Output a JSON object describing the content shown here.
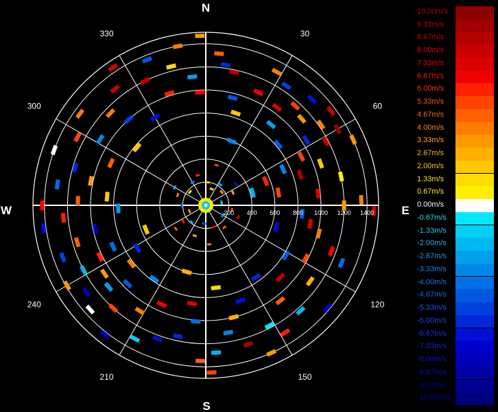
{
  "chart_data": {
    "type": "polar-radial-velocity",
    "compass": {
      "north": "N",
      "east": "E",
      "south": "S",
      "west": "W"
    },
    "angle_labels": [
      {
        "angle": 30,
        "text": "30"
      },
      {
        "angle": 60,
        "text": "60"
      },
      {
        "angle": 120,
        "text": "120"
      },
      {
        "angle": 150,
        "text": "150"
      },
      {
        "angle": 210,
        "text": "210"
      },
      {
        "angle": 240,
        "text": "240"
      },
      {
        "angle": 300,
        "text": "300"
      },
      {
        "angle": 330,
        "text": "330"
      }
    ],
    "range_rings": [
      200,
      400,
      600,
      800,
      1000,
      1200,
      1400
    ],
    "range_labels": [
      {
        "value": 200,
        "text": "200"
      },
      {
        "value": 400,
        "text": "400"
      },
      {
        "value": 600,
        "text": "600"
      },
      {
        "value": 800,
        "text": "800"
      },
      {
        "value": 1000,
        "text": "1000"
      },
      {
        "value": 1200,
        "text": "1200"
      },
      {
        "value": 1400,
        "text": "1400"
      }
    ],
    "range_max": 1400,
    "spoke_angles": [
      0,
      30,
      60,
      90,
      120,
      150,
      180,
      210,
      240,
      270,
      300,
      330
    ],
    "colorbar": {
      "min": -10,
      "max": 10,
      "unit": "m/s",
      "entries": [
        {
          "label": "10.00m/s",
          "value": 10.0,
          "color": "#8c0000",
          "text_color": "#b00000"
        },
        {
          "label": "9.33m/s",
          "value": 9.33,
          "color": "#a00000",
          "text_color": "#c00000"
        },
        {
          "label": "8.67m/s",
          "value": 8.67,
          "color": "#b40000",
          "text_color": "#d00000"
        },
        {
          "label": "8.00m/s",
          "value": 8.0,
          "color": "#c80000",
          "text_color": "#e00000"
        },
        {
          "label": "7.33m/s",
          "value": 7.33,
          "color": "#dc0000",
          "text_color": "#ee0000"
        },
        {
          "label": "6.67m/s",
          "value": 6.67,
          "color": "#f00000",
          "text_color": "#ff1010"
        },
        {
          "label": "6.00m/s",
          "value": 6.0,
          "color": "#ff2000",
          "text_color": "#ff3010"
        },
        {
          "label": "5.33m/s",
          "value": 5.33,
          "color": "#ff4400",
          "text_color": "#ff5020"
        },
        {
          "label": "4.67m/s",
          "value": 4.67,
          "color": "#ff6000",
          "text_color": "#ff6a20"
        },
        {
          "label": "4.00m/s",
          "value": 4.0,
          "color": "#ff7c00",
          "text_color": "#ff8420"
        },
        {
          "label": "3.33m/s",
          "value": 3.33,
          "color": "#ff9800",
          "text_color": "#ff9c20"
        },
        {
          "label": "2.67m/s",
          "value": 2.67,
          "color": "#ffb000",
          "text_color": "#ffb420"
        },
        {
          "label": "2.00m/s",
          "value": 2.0,
          "color": "#ffc800",
          "text_color": "#ffcc20"
        },
        {
          "label": "1.33m/s",
          "value": 1.33,
          "color": "#ffdc00",
          "text_color": "#ffe020"
        },
        {
          "label": "0.67m/s",
          "value": 0.67,
          "color": "#fff000",
          "text_color": "#fff020"
        },
        {
          "label": "0.00m/s",
          "value": 0.0,
          "color": "#ffffff",
          "text_color": "#ffffff"
        },
        {
          "label": "-0.67m/s",
          "value": -0.67,
          "color": "#00e8f8",
          "text_color": "#20e0f0"
        },
        {
          "label": "-1.33m/s",
          "value": -1.33,
          "color": "#00d0f4",
          "text_color": "#20c8f0"
        },
        {
          "label": "-2.00m/s",
          "value": -2.0,
          "color": "#00b8f0",
          "text_color": "#20b0f0"
        },
        {
          "label": "-2.67m/s",
          "value": -2.67,
          "color": "#00a0ec",
          "text_color": "#2098f0"
        },
        {
          "label": "-3.33m/s",
          "value": -3.33,
          "color": "#0088e8",
          "text_color": "#2080f0"
        },
        {
          "label": "-4.00m/s",
          "value": -4.0,
          "color": "#0070e4",
          "text_color": "#2070f0"
        },
        {
          "label": "-4.67m/s",
          "value": -4.67,
          "color": "#0058e0",
          "text_color": "#2060f0"
        },
        {
          "label": "-5.33m/s",
          "value": -5.33,
          "color": "#0040dc",
          "text_color": "#2050f0"
        },
        {
          "label": "-6.00m/s",
          "value": -6.0,
          "color": "#0028d8",
          "text_color": "#2040f0"
        },
        {
          "label": "-6.67m/s",
          "value": -6.67,
          "color": "#0010d4",
          "text_color": "#2030f0"
        },
        {
          "label": "-7.33m/s",
          "value": -7.33,
          "color": "#0000cc",
          "text_color": "#1020e0"
        },
        {
          "label": "-8.00m/s",
          "value": -8.0,
          "color": "#0000b8",
          "text_color": "#1010d0"
        },
        {
          "label": "-8.67m/s",
          "value": -8.67,
          "color": "#0000a4",
          "text_color": "#0808c0"
        },
        {
          "label": "-9.33m/s",
          "value": -9.33,
          "color": "#000090",
          "text_color": "#0000b0"
        },
        {
          "label": "-10.00m/s",
          "value": -10.0,
          "color": "#00007c",
          "text_color": "#0000a0"
        }
      ]
    },
    "bins": [
      {
        "az": 5,
        "r": 1320,
        "v": 4.7
      },
      {
        "az": 8,
        "r": 1230,
        "v": -6.0
      },
      {
        "az": 12,
        "r": 1180,
        "v": 8.6
      },
      {
        "az": 14,
        "r": 960,
        "v": -4.5
      },
      {
        "az": 18,
        "r": 840,
        "v": 2.2
      },
      {
        "az": 22,
        "r": 600,
        "v": -3.4
      },
      {
        "az": 25,
        "r": 1080,
        "v": 6.5
      },
      {
        "az": 28,
        "r": 1310,
        "v": 3.8
      },
      {
        "az": 34,
        "r": 1250,
        "v": -5.5
      },
      {
        "az": 36,
        "r": 1050,
        "v": 7.3
      },
      {
        "az": 39,
        "r": 900,
        "v": -2.7
      },
      {
        "az": 42,
        "r": 1160,
        "v": 5.0
      },
      {
        "az": 45,
        "r": 1300,
        "v": -7.0
      },
      {
        "az": 48,
        "r": 1120,
        "v": 3.3
      },
      {
        "az": 50,
        "r": 820,
        "v": -4.4
      },
      {
        "az": 53,
        "r": 1360,
        "v": 8.0
      },
      {
        "az": 55,
        "r": 1220,
        "v": 4.2
      },
      {
        "az": 57,
        "r": 1040,
        "v": -6.3
      },
      {
        "az": 60,
        "r": 1320,
        "v": 9.0
      },
      {
        "az": 62,
        "r": 1180,
        "v": 7.8
      },
      {
        "az": 63,
        "r": 930,
        "v": 5.6
      },
      {
        "az": 65,
        "r": 740,
        "v": -3.2
      },
      {
        "az": 66,
        "r": 1400,
        "v": 3.0
      },
      {
        "az": 68,
        "r": 560,
        "v": 6.2
      },
      {
        "az": 70,
        "r": 1060,
        "v": 1.8
      },
      {
        "az": 72,
        "r": 860,
        "v": 8.4
      },
      {
        "az": 75,
        "r": 420,
        "v": -2.0
      },
      {
        "az": 78,
        "r": 1200,
        "v": 0.8
      },
      {
        "az": 80,
        "r": 640,
        "v": 5.3
      },
      {
        "az": 84,
        "r": 980,
        "v": 7.0
      },
      {
        "az": 88,
        "r": 1350,
        "v": 4.0
      },
      {
        "az": 90,
        "r": 1200,
        "v": 3.0
      },
      {
        "az": 92,
        "r": 1460,
        "v": 8.0
      },
      {
        "az": 95,
        "r": 840,
        "v": -5.0
      },
      {
        "az": 100,
        "r": 920,
        "v": 7.5
      },
      {
        "az": 104,
        "r": 1010,
        "v": 4.3
      },
      {
        "az": 107,
        "r": 640,
        "v": -6.6
      },
      {
        "az": 110,
        "r": 1160,
        "v": 6.9
      },
      {
        "az": 113,
        "r": 1280,
        "v": -3.7
      },
      {
        "az": 118,
        "r": 980,
        "v": 5.5
      },
      {
        "az": 122,
        "r": 820,
        "v": -4.9
      },
      {
        "az": 126,
        "r": 1120,
        "v": 2.5
      },
      {
        "az": 130,
        "r": 1380,
        "v": -7.4
      },
      {
        "az": 134,
        "r": 900,
        "v": 7.7
      },
      {
        "az": 138,
        "r": 1230,
        "v": -2.3
      },
      {
        "az": 142,
        "r": 1050,
        "v": 4.6
      },
      {
        "az": 145,
        "r": 760,
        "v": -5.8
      },
      {
        "az": 148,
        "r": 1300,
        "v": 6.1
      },
      {
        "az": 152,
        "r": 1180,
        "v": -0.5
      },
      {
        "az": 156,
        "r": 1400,
        "v": 3.5
      },
      {
        "az": 160,
        "r": 880,
        "v": -6.9
      },
      {
        "az": 163,
        "r": 1260,
        "v": 9.4
      },
      {
        "az": 166,
        "r": 1000,
        "v": 2.8
      },
      {
        "az": 170,
        "r": 1120,
        "v": -3.1
      },
      {
        "az": 173,
        "r": 720,
        "v": 1.6
      },
      {
        "az": 176,
        "r": 1280,
        "v": -2.2
      },
      {
        "az": 178,
        "r": 1450,
        "v": 5.2
      },
      {
        "az": 182,
        "r": 1350,
        "v": 4.4
      },
      {
        "az": 185,
        "r": 1010,
        "v": -4.2
      },
      {
        "az": 188,
        "r": 860,
        "v": 7.6
      },
      {
        "az": 192,
        "r": 1160,
        "v": -5.9
      },
      {
        "az": 196,
        "r": 600,
        "v": 2.6
      },
      {
        "az": 200,
        "r": 1230,
        "v": -6.4
      },
      {
        "az": 204,
        "r": 940,
        "v": 6.6
      },
      {
        "az": 208,
        "r": 1310,
        "v": -1.4
      },
      {
        "az": 212,
        "r": 1080,
        "v": 3.9
      },
      {
        "az": 215,
        "r": 780,
        "v": -3.6
      },
      {
        "az": 218,
        "r": 1420,
        "v": -7.8
      },
      {
        "az": 222,
        "r": 1200,
        "v": 5.4
      },
      {
        "az": 225,
        "r": 960,
        "v": -4.6
      },
      {
        "az": 228,
        "r": 1350,
        "v": 0.3
      },
      {
        "az": 230,
        "r": 1100,
        "v": -2.5
      },
      {
        "az": 232,
        "r": 820,
        "v": 4.1
      },
      {
        "az": 234,
        "r": 1280,
        "v": -8.3
      },
      {
        "az": 236,
        "r": 1060,
        "v": 3.1
      },
      {
        "az": 238,
        "r": 700,
        "v": -6.1
      },
      {
        "az": 240,
        "r": 1390,
        "v": 3.6
      },
      {
        "az": 242,
        "r": 1200,
        "v": -1.9
      },
      {
        "az": 244,
        "r": 1020,
        "v": 6.3
      },
      {
        "az": 246,
        "r": 880,
        "v": -3.9
      },
      {
        "az": 248,
        "r": 560,
        "v": 2.0
      },
      {
        "az": 250,
        "r": 1320,
        "v": -5.1
      },
      {
        "az": 254,
        "r": 1160,
        "v": 4.8
      },
      {
        "az": 258,
        "r": 980,
        "v": -7.2
      },
      {
        "az": 262,
        "r": 1420,
        "v": -6.8
      },
      {
        "az": 265,
        "r": 1240,
        "v": 5.8
      },
      {
        "az": 268,
        "r": 760,
        "v": -2.9
      },
      {
        "az": 270,
        "r": 1420,
        "v": 6.7
      },
      {
        "az": 272,
        "r": 1110,
        "v": 4.5
      },
      {
        "az": 275,
        "r": 860,
        "v": 2.3
      },
      {
        "az": 278,
        "r": 1300,
        "v": -4.3
      },
      {
        "az": 282,
        "r": 1020,
        "v": 3.4
      },
      {
        "az": 286,
        "r": 1180,
        "v": -6.2
      },
      {
        "az": 290,
        "r": 1400,
        "v": 0.1
      },
      {
        "az": 294,
        "r": 900,
        "v": 4.9
      },
      {
        "az": 298,
        "r": 1260,
        "v": 5.1
      },
      {
        "az": 302,
        "r": 1080,
        "v": -3.3
      },
      {
        "az": 306,
        "r": 1350,
        "v": 4.2
      },
      {
        "az": 310,
        "r": 780,
        "v": 2.1
      },
      {
        "az": 314,
        "r": 1150,
        "v": 3.7
      },
      {
        "az": 318,
        "r": 1000,
        "v": -5.2
      },
      {
        "az": 322,
        "r": 1280,
        "v": 7.9
      },
      {
        "az": 326,
        "r": 1440,
        "v": 7.2
      },
      {
        "az": 330,
        "r": 880,
        "v": -6.5
      },
      {
        "az": 334,
        "r": 1200,
        "v": 8.2
      },
      {
        "az": 338,
        "r": 1360,
        "v": -4.7
      },
      {
        "az": 342,
        "r": 1020,
        "v": 6.0
      },
      {
        "az": 346,
        "r": 1240,
        "v": 1.2
      },
      {
        "az": 350,
        "r": 1400,
        "v": 4.0
      },
      {
        "az": 354,
        "r": 1120,
        "v": -2.6
      },
      {
        "az": 357,
        "r": 980,
        "v": 6.8
      },
      {
        "az": 358,
        "r": 1470,
        "v": 3.0
      }
    ],
    "inner_clutter": [
      {
        "az": 20,
        "r": 150,
        "v": 1.5
      },
      {
        "az": 35,
        "r": 220,
        "v": -2.0
      },
      {
        "az": 50,
        "r": 180,
        "v": 3.5
      },
      {
        "az": 65,
        "r": 260,
        "v": 2.4
      },
      {
        "az": 80,
        "r": 140,
        "v": -1.2
      },
      {
        "az": 100,
        "r": 230,
        "v": 5.0
      },
      {
        "az": 120,
        "r": 170,
        "v": -3.0
      },
      {
        "az": 140,
        "r": 250,
        "v": 4.4
      },
      {
        "az": 160,
        "r": 200,
        "v": 6.5
      },
      {
        "az": 185,
        "r": 160,
        "v": -4.5
      },
      {
        "az": 200,
        "r": 280,
        "v": 2.8
      },
      {
        "az": 220,
        "r": 190,
        "v": -2.4
      },
      {
        "az": 235,
        "r": 240,
        "v": 5.8
      },
      {
        "az": 250,
        "r": 150,
        "v": 3.1
      },
      {
        "az": 270,
        "r": 210,
        "v": -5.5
      },
      {
        "az": 290,
        "r": 260,
        "v": 4.0
      },
      {
        "az": 310,
        "r": 180,
        "v": 1.0
      },
      {
        "az": 330,
        "r": 230,
        "v": -3.6
      },
      {
        "az": 345,
        "r": 270,
        "v": 6.0
      },
      {
        "az": 5,
        "r": 200,
        "v": 2.2
      },
      {
        "az": 55,
        "r": 320,
        "v": -6.8
      },
      {
        "az": 110,
        "r": 300,
        "v": 7.0
      },
      {
        "az": 175,
        "r": 340,
        "v": 3.8
      },
      {
        "az": 232,
        "r": 330,
        "v": 4.6
      },
      {
        "az": 300,
        "r": 310,
        "v": -1.8
      },
      {
        "az": 15,
        "r": 360,
        "v": 5.2
      }
    ]
  }
}
